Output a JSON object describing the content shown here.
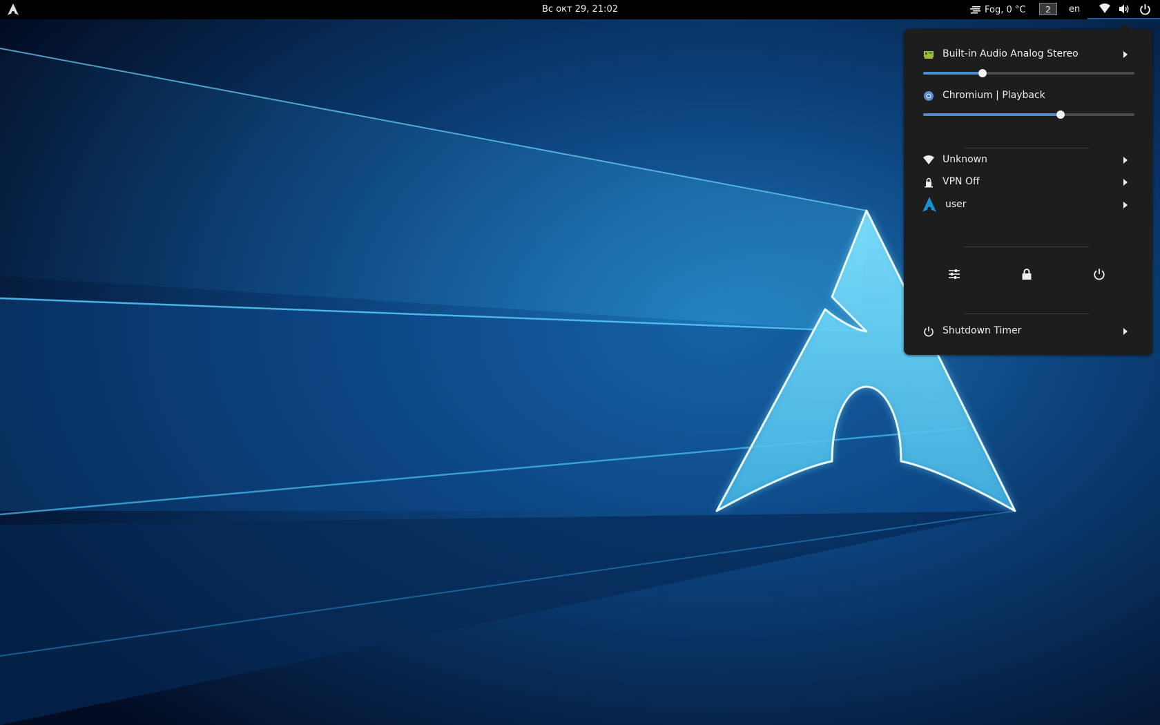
{
  "topbar": {
    "clock": "Вс окт 29, 21:02",
    "weather": "Fog, 0 °C",
    "workspace": "2",
    "language": "en"
  },
  "menu": {
    "audio_output": {
      "label": "Built-in Audio Analog Stereo",
      "volume": 0.28
    },
    "app_stream": {
      "label": "Chromium | Playback",
      "volume": 0.65
    },
    "wifi": {
      "label": "Unknown"
    },
    "vpn": {
      "label": "VPN Off"
    },
    "user": {
      "label": "user"
    },
    "shutdown_timer": {
      "label": "Shutdown Timer"
    }
  },
  "colors": {
    "accent": "#4f8bc8",
    "menu_bg": "#1d1d1d",
    "panel_bg": "#000000",
    "text": "#eeeeec",
    "wallpaper_glow": "#7fe3ff"
  },
  "icons": [
    "arch-logo-icon",
    "weather-fog-icon",
    "wifi-icon",
    "volume-icon",
    "power-icon",
    "soundcard-icon",
    "chromium-icon",
    "vpn-lock-icon",
    "settings-icon",
    "lock-icon",
    "power-off-icon",
    "chevron-right-icon"
  ]
}
